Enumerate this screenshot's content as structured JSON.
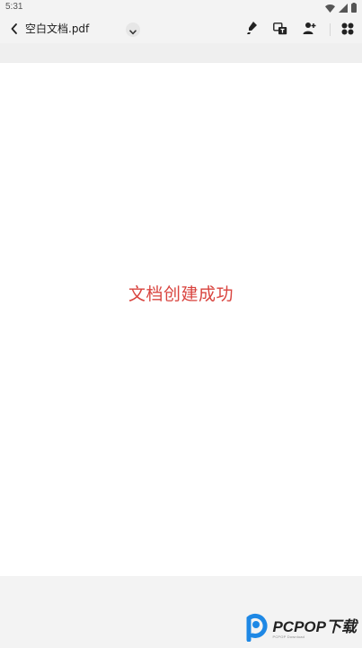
{
  "status_bar": {
    "time": "5:31",
    "icons": [
      "wifi-icon",
      "signal-icon",
      "battery-icon"
    ]
  },
  "toolbar": {
    "back_icon": "chevron-left-icon",
    "title": "空白文档.pdf",
    "dropdown_icon": "chevron-down-icon",
    "actions": [
      {
        "name": "highlighter-icon"
      },
      {
        "name": "translate-icon"
      },
      {
        "name": "share-user-icon"
      },
      {
        "name": "apps-grid-icon"
      }
    ]
  },
  "document": {
    "message": "文档创建成功",
    "message_color": "#d9443f"
  },
  "watermark": {
    "text": "PCPOP下载",
    "subtext": "PCPOP Download",
    "brand_color": "#1e88e5"
  }
}
